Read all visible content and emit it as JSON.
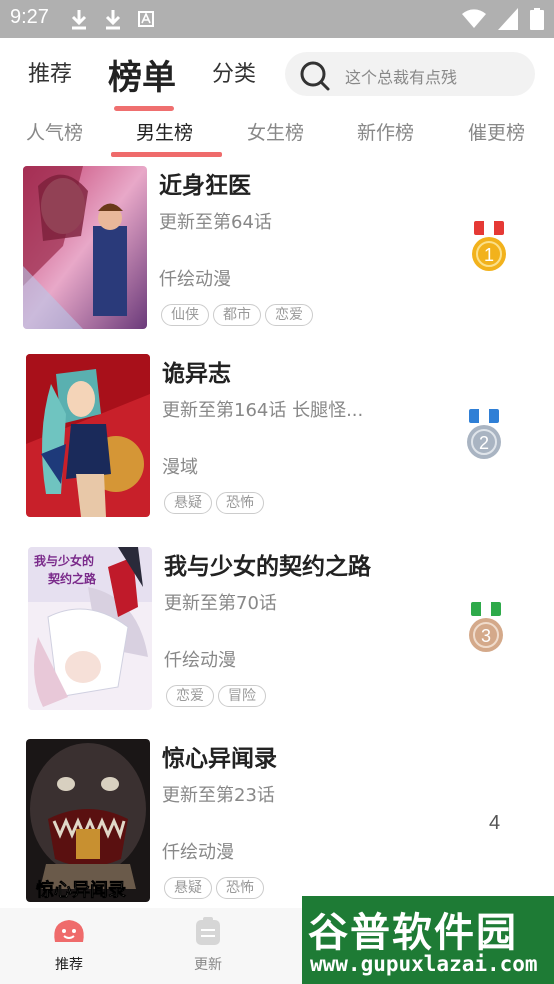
{
  "status_bar": {
    "time": "9:27",
    "left_icons": [
      "download-icon",
      "download-icon",
      "font-icon"
    ],
    "right_icons": [
      "wifi-icon",
      "signal-icon",
      "battery-icon"
    ]
  },
  "top_nav": {
    "tabs": [
      {
        "label": "推荐",
        "active": false
      },
      {
        "label": "榜单",
        "active": true
      },
      {
        "label": "分类",
        "active": false
      }
    ],
    "search_placeholder": "这个总裁有点残"
  },
  "sub_tabs": [
    {
      "label": "人气榜",
      "active": false
    },
    {
      "label": "男生榜",
      "active": true
    },
    {
      "label": "女生榜",
      "active": false
    },
    {
      "label": "新作榜",
      "active": false
    },
    {
      "label": "催更榜",
      "active": false
    }
  ],
  "list": [
    {
      "title": "近身狂医",
      "update": "更新至第64话",
      "author": "仟绘动漫",
      "tags": [
        "仙侠",
        "都市",
        "恋爱"
      ],
      "rank": "1",
      "medal": "gold-medal-icon"
    },
    {
      "title": "诡异志",
      "update": "更新至第164话 长腿怪...",
      "author": "漫域",
      "tags": [
        "悬疑",
        "恐怖"
      ],
      "rank": "2",
      "medal": "silver-medal-icon"
    },
    {
      "title": "我与少女的契约之路",
      "update": "更新至第70话",
      "author": "仟绘动漫",
      "tags": [
        "恋爱",
        "冒险"
      ],
      "rank": "3",
      "medal": "bronze-medal-icon"
    },
    {
      "title": "惊心异闻录",
      "update": "更新至第23话",
      "author": "仟绘动漫",
      "tags": [
        "悬疑",
        "恐怖"
      ],
      "rank": "4"
    }
  ],
  "bottom_nav": [
    {
      "label": "推荐",
      "icon": "smile-icon",
      "active": true
    },
    {
      "label": "更新",
      "icon": "update-icon",
      "active": false
    }
  ],
  "watermark": {
    "main": "谷普软件园",
    "url": "www.gupuxlazai.com"
  },
  "colors": {
    "accent": "#ef6b6b",
    "status_bar": "#b0b0b0",
    "gold": "#f2b21c",
    "silver": "#a9b4c2",
    "bronze": "#d4a98a"
  }
}
